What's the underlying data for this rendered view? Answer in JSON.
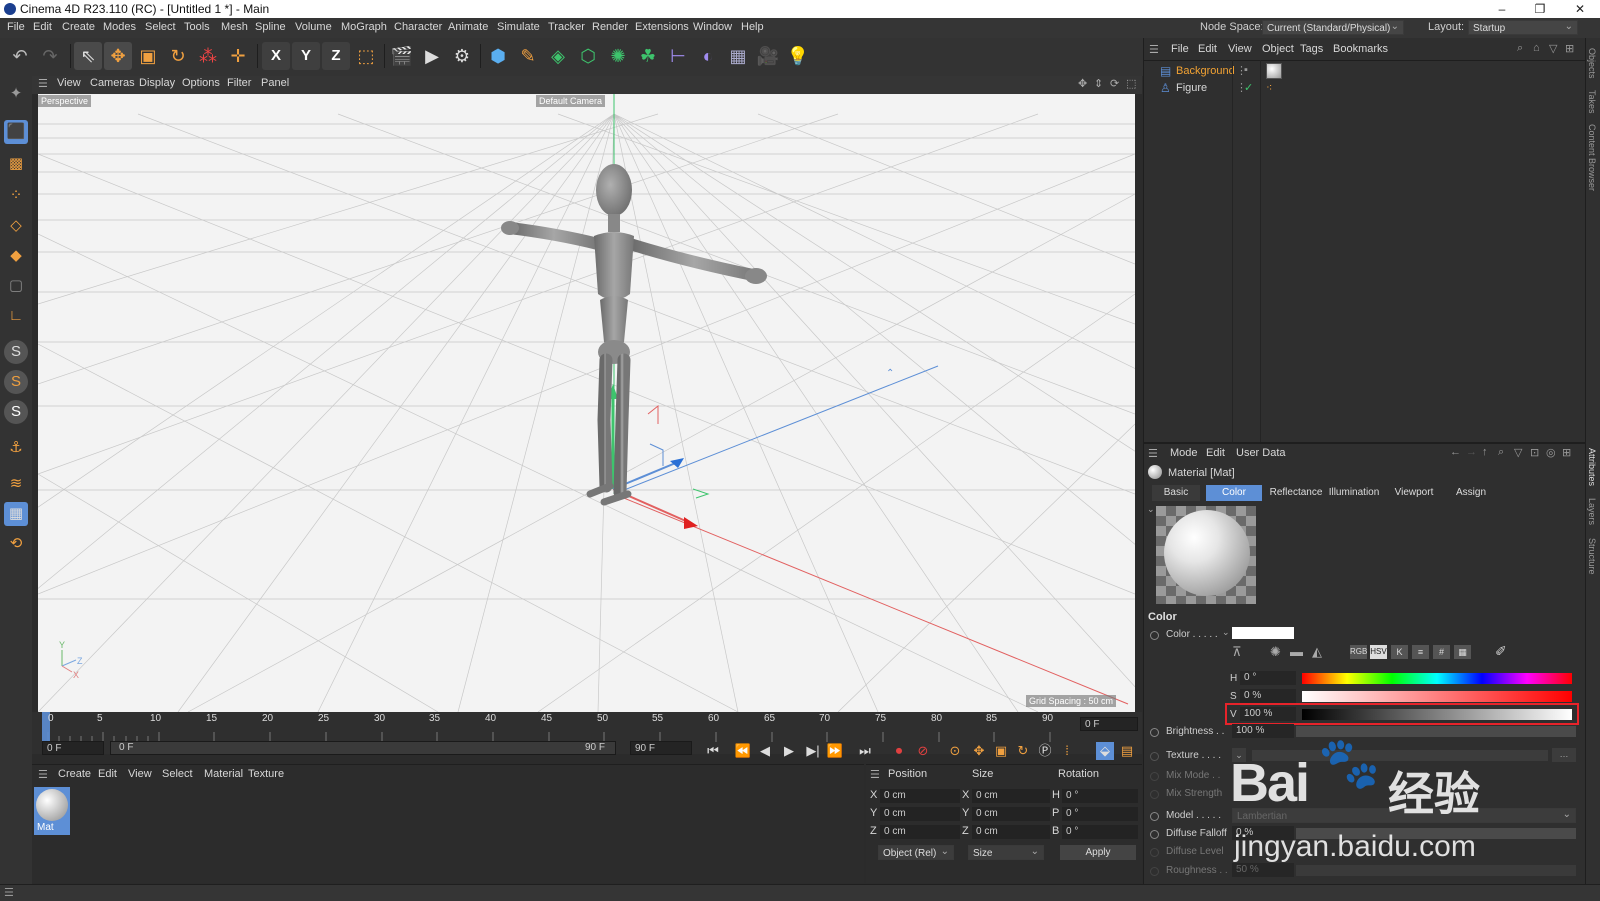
{
  "window": {
    "title": "Cinema 4D R23.110 (RC) - [Untitled 1 *] - Main",
    "minimize": "–",
    "maximize": "❐",
    "close": "✕"
  },
  "menubar": {
    "items": [
      "File",
      "Edit",
      "Create",
      "Modes",
      "Select",
      "Tools",
      "Mesh",
      "Spline",
      "Volume",
      "MoGraph",
      "Character",
      "Animate",
      "Simulate",
      "Tracker",
      "Render",
      "Extensions",
      "Window",
      "Help"
    ],
    "node_space_label": "Node Space:",
    "node_space_value": "Current (Standard/Physical)",
    "layout_label": "Layout:",
    "layout_value": "Startup"
  },
  "toolbar": {
    "axis_x": "X",
    "axis_y": "Y",
    "axis_z": "Z"
  },
  "viewport": {
    "menu": [
      "View",
      "Cameras",
      "Display",
      "Options",
      "Filter",
      "Panel"
    ],
    "view_name": "Perspective",
    "camera_name": "Default Camera",
    "grid_spacing": "Grid Spacing : 50 cm",
    "axis_y": "Y",
    "axis_z": "Z",
    "axis_x": "X"
  },
  "timeline": {
    "ticks": [
      "0",
      "5",
      "10",
      "15",
      "20",
      "25",
      "30",
      "35",
      "40",
      "45",
      "50",
      "55",
      "60",
      "65",
      "70",
      "75",
      "80",
      "85",
      "90"
    ],
    "current_frame_right": "0 F",
    "start_field": "0 F",
    "range_start": "0 F",
    "range_end": "90 F",
    "end_field": "90 F"
  },
  "material_manager": {
    "menu": [
      "Create",
      "Edit",
      "View",
      "Select",
      "Material",
      "Texture"
    ],
    "materials": [
      {
        "name": "Mat"
      }
    ]
  },
  "coordinates": {
    "headers": {
      "position": "Position",
      "size": "Size",
      "rotation": "Rotation"
    },
    "rows": [
      {
        "axis": "X",
        "position": "0 cm",
        "size_axis": "X",
        "size": "0 cm",
        "rot_axis": "H",
        "rotation": "0 °"
      },
      {
        "axis": "Y",
        "position": "0 cm",
        "size_axis": "Y",
        "size": "0 cm",
        "rot_axis": "P",
        "rotation": "0 °"
      },
      {
        "axis": "Z",
        "position": "0 cm",
        "size_axis": "Z",
        "size": "0 cm",
        "rot_axis": "B",
        "rotation": "0 °"
      }
    ],
    "mode_select": "Object (Rel)",
    "size_select": "Size",
    "apply_label": "Apply"
  },
  "object_manager": {
    "menu": [
      "File",
      "Edit",
      "View",
      "Object",
      "Tags",
      "Bookmarks"
    ],
    "objects": [
      {
        "name": "Background",
        "selected": true
      },
      {
        "name": "Figure",
        "selected": false
      }
    ]
  },
  "attribute_manager": {
    "menu": [
      "Mode",
      "Edit",
      "User Data"
    ],
    "material_title": "Material [Mat]",
    "tabs": [
      "Basic",
      "Color",
      "Reflectance",
      "Illumination",
      "Viewport",
      "Assign"
    ],
    "active_tab": "Color",
    "section": "Color",
    "color_label": "Color . . . . .",
    "color_swatch": "#ffffff",
    "hsv": [
      {
        "label": "H",
        "value": "0 °"
      },
      {
        "label": "S",
        "value": "0 %"
      },
      {
        "label": "V",
        "value": "100 %"
      }
    ],
    "mode_buttons": [
      "RGB",
      "HSV",
      "K",
      "≡",
      "#",
      "▦"
    ],
    "brightness_label": "Brightness . .",
    "brightness_value": "100 %",
    "texture_label": "Texture . . . .",
    "mix_mode_label": "Mix Mode . .",
    "mix_strength_label": "Mix Strength",
    "model_label": "Model . . . . .",
    "model_value": "Lambertian",
    "diffuse_falloff_label": "Diffuse Falloff",
    "diffuse_falloff_value": "0 %",
    "diffuse_level_label": "Diffuse Level",
    "roughness_label": "Roughness . .",
    "roughness_value": "50 %"
  },
  "right_strip": [
    "Objects",
    "Takes",
    "Content Browser",
    "Attributes",
    "Layers",
    "Structure"
  ],
  "watermark": {
    "brand": "Bai",
    "brand2": "经验",
    "url": "jingyan.baidu.com"
  },
  "colors": {
    "accent": "#5d8fd6",
    "highlight_box": "#e8232a",
    "selected_text": "#f2a233"
  }
}
